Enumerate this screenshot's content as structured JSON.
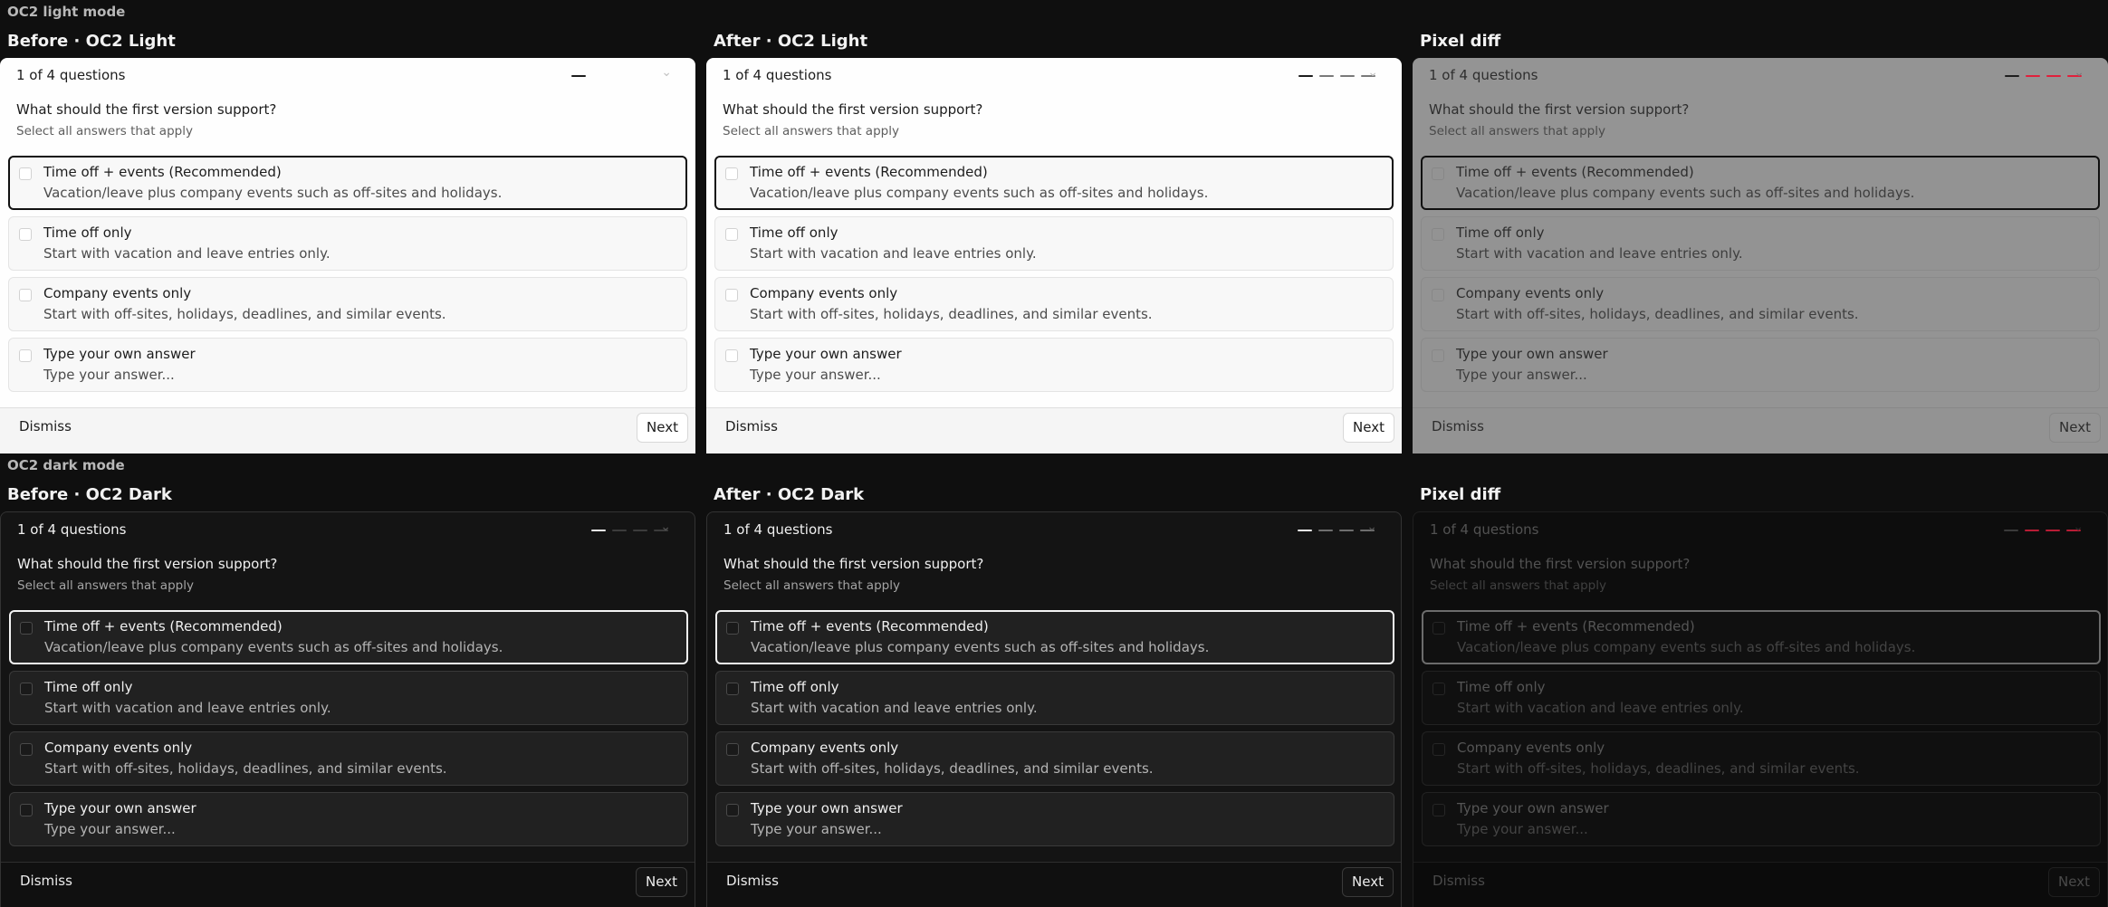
{
  "sections": {
    "light_label": "OC2 light mode",
    "dark_label": "OC2 dark mode"
  },
  "columns": {
    "before_light": "Before · OC2 Light",
    "after_light": "After · OC2 Light",
    "diff_light": "Pixel diff",
    "before_dark": "Before · OC2 Dark",
    "after_dark": "After · OC2 Dark",
    "diff_dark": "Pixel diff"
  },
  "dialog": {
    "counter": "1 of 4 questions",
    "question": "What should the first version support?",
    "hint": "Select all answers that apply",
    "options": [
      {
        "title": "Time off + events (Recommended)",
        "desc": "Vacation/leave plus company events such as off-sites and holidays."
      },
      {
        "title": "Time off only",
        "desc": "Start with vacation and leave entries only."
      },
      {
        "title": "Company events only",
        "desc": "Start with off-sites, holidays, deadlines, and similar events."
      },
      {
        "title": "Type your own answer",
        "desc": "Type your answer..."
      }
    ],
    "dismiss_label": "Dismiss",
    "next_label": "Next",
    "chevron_icon": "chevron-down-icon",
    "checkbox_icon": "checkbox-empty-icon"
  },
  "colors": {
    "diff_highlight": "#e0203c",
    "light_selected_border": "#111111",
    "dark_selected_border": "#f4f4f4"
  }
}
